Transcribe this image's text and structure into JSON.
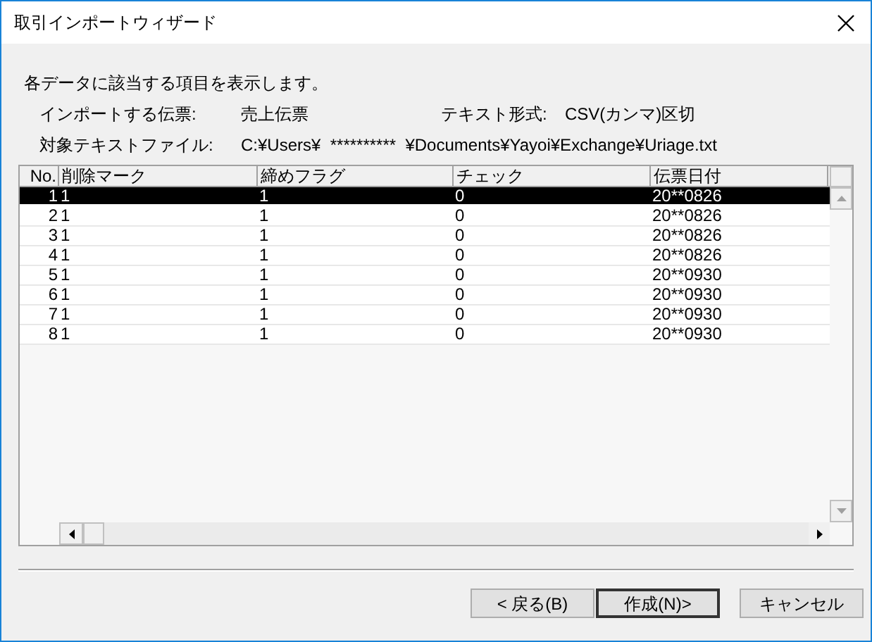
{
  "window": {
    "title": "取引インポートウィザード"
  },
  "intro": "各データに該当する項目を表示します。",
  "info": [
    {
      "label": "インポートする伝票:",
      "value": "売上伝票"
    },
    {
      "label": "テキスト形式:",
      "value": "CSV(カンマ)区切"
    },
    {
      "label": "対象テキストファイル:",
      "value": "C:¥Users¥  **********  ¥Documents¥Yayoi¥Exchange¥Uriage.txt"
    }
  ],
  "table": {
    "columns": [
      "No.",
      "削除マーク",
      "締めフラグ",
      "チェック",
      "伝票日付"
    ],
    "rows": [
      {
        "cells": [
          "1",
          "1",
          "1",
          "0",
          "20**0826"
        ],
        "selected": true
      },
      {
        "cells": [
          "2",
          "1",
          "1",
          "0",
          "20**0826"
        ],
        "selected": false
      },
      {
        "cells": [
          "3",
          "1",
          "1",
          "0",
          "20**0826"
        ],
        "selected": false
      },
      {
        "cells": [
          "4",
          "1",
          "1",
          "0",
          "20**0826"
        ],
        "selected": false
      },
      {
        "cells": [
          "5",
          "1",
          "1",
          "0",
          "20**0930"
        ],
        "selected": false
      },
      {
        "cells": [
          "6",
          "1",
          "1",
          "0",
          "20**0930"
        ],
        "selected": false
      },
      {
        "cells": [
          "7",
          "1",
          "1",
          "0",
          "20**0930"
        ],
        "selected": false
      },
      {
        "cells": [
          "8",
          "1",
          "1",
          "0",
          "20**0930"
        ],
        "selected": false
      }
    ]
  },
  "buttons": [
    {
      "label": "< 戻る(B)",
      "default": false
    },
    {
      "label": "作成(N)>",
      "default": true
    },
    {
      "label": "キャンセル",
      "default": false
    }
  ]
}
